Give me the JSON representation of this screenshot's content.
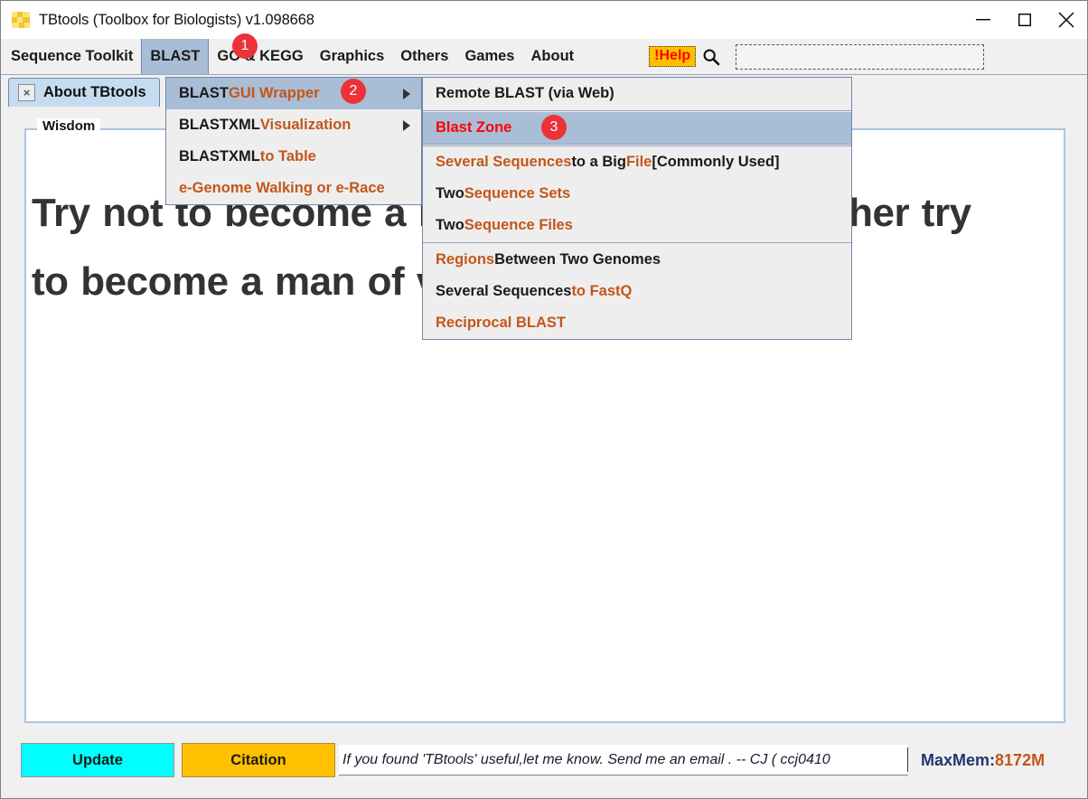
{
  "window": {
    "title": "TBtools (Toolbox for Biologists) v1.098668",
    "app_icon": "tbtools-logo-icon",
    "controls": [
      {
        "name": "minimize-button",
        "glyph": "minimize-icon"
      },
      {
        "name": "maximize-button",
        "glyph": "maximize-icon"
      },
      {
        "name": "close-button",
        "glyph": "close-icon"
      }
    ]
  },
  "menubar": {
    "items": [
      {
        "label": "Sequence Toolkit",
        "selected": false
      },
      {
        "label": "BLAST",
        "selected": true
      },
      {
        "label": "GO & KEGG",
        "selected": false
      },
      {
        "label": "Graphics",
        "selected": false
      },
      {
        "label": "Others",
        "selected": false
      },
      {
        "label": "Games",
        "selected": false
      },
      {
        "label": "About",
        "selected": false
      }
    ],
    "help_label": "!Help",
    "help_bg_color": "#ffc000",
    "help_text_color": "#ff0000",
    "search_icon": "magnifier-icon",
    "search_placeholder": ""
  },
  "tabs": [
    {
      "label": "About TBtools",
      "close_glyph": "×",
      "active": true
    }
  ],
  "wisdom": {
    "legend": "Wisdom",
    "quote": "Try not to become a man of success but rather try to become a man of value.--A. Einstein"
  },
  "menu_blast": {
    "items": [
      {
        "name": "blast-gui-wrapper",
        "parts": [
          {
            "text": "BLAST ",
            "color": "dark"
          },
          {
            "text": "GUI Wrapper",
            "color": "orange"
          }
        ],
        "submenu": true,
        "highlight": true
      },
      {
        "name": "blastxml-visualization",
        "parts": [
          {
            "text": "BLASTXML ",
            "color": "dark"
          },
          {
            "text": "Visualization",
            "color": "orange"
          }
        ],
        "submenu": true,
        "highlight": false
      },
      {
        "name": "blastxml-to-table",
        "parts": [
          {
            "text": "BLASTXML ",
            "color": "dark"
          },
          {
            "text": "to Table",
            "color": "orange"
          }
        ],
        "submenu": false,
        "highlight": false
      },
      {
        "name": "e-genome-walking-or-e-race",
        "parts": [
          {
            "text": "e-Genome Walking or e-Race",
            "color": "orange"
          }
        ],
        "submenu": false,
        "highlight": false
      }
    ]
  },
  "menu_gui_wrapper": {
    "items": [
      {
        "name": "remote-blast-via-web",
        "parts": [
          {
            "text": "Remote BLAST (via Web)",
            "color": "dark"
          }
        ],
        "highlight": false,
        "separator_after": true
      },
      {
        "name": "blast-zone",
        "parts": [
          {
            "text": "Blast Zone",
            "color": "red"
          }
        ],
        "highlight": true,
        "separator_after": true
      },
      {
        "name": "several-sequences-to-a-big-file",
        "parts": [
          {
            "text": "Several Sequences ",
            "color": "orange"
          },
          {
            "text": "to a Big ",
            "color": "dark"
          },
          {
            "text": "File ",
            "color": "orange"
          },
          {
            "text": "[Commonly Used]",
            "color": "dark"
          }
        ],
        "highlight": false,
        "separator_after": false
      },
      {
        "name": "two-sequence-sets",
        "parts": [
          {
            "text": "Two ",
            "color": "dark"
          },
          {
            "text": "Sequence Sets",
            "color": "orange"
          }
        ],
        "highlight": false,
        "separator_after": false
      },
      {
        "name": "two-sequence-files",
        "parts": [
          {
            "text": "Two ",
            "color": "dark"
          },
          {
            "text": "Sequence Files",
            "color": "orange"
          }
        ],
        "highlight": false,
        "separator_after": true
      },
      {
        "name": "regions-between-two-genomes",
        "parts": [
          {
            "text": "Regions ",
            "color": "orange"
          },
          {
            "text": "Between Two Genomes",
            "color": "dark"
          }
        ],
        "highlight": false,
        "separator_after": false
      },
      {
        "name": "several-sequences-to-fastq",
        "parts": [
          {
            "text": "Several Sequences ",
            "color": "dark"
          },
          {
            "text": "to FastQ",
            "color": "orange"
          }
        ],
        "highlight": false,
        "separator_after": false
      },
      {
        "name": "reciprocal-blast",
        "parts": [
          {
            "text": "Reciprocal BLAST",
            "color": "orange"
          }
        ],
        "highlight": false,
        "separator_after": false
      }
    ]
  },
  "badges": [
    {
      "label": "1",
      "target": "menubar-blast"
    },
    {
      "label": "2",
      "target": "blast-gui-wrapper"
    },
    {
      "label": "3",
      "target": "blast-zone"
    }
  ],
  "bottom": {
    "update_label": "Update",
    "update_color": "#00ffff",
    "citation_label": "Citation",
    "citation_color": "#ffc000",
    "status_text": "If you found 'TBtools' useful,let me know. Send me an email . -- CJ   ( ccj0410",
    "maxmem_key": "MaxMem:",
    "maxmem_value": "8172M"
  }
}
